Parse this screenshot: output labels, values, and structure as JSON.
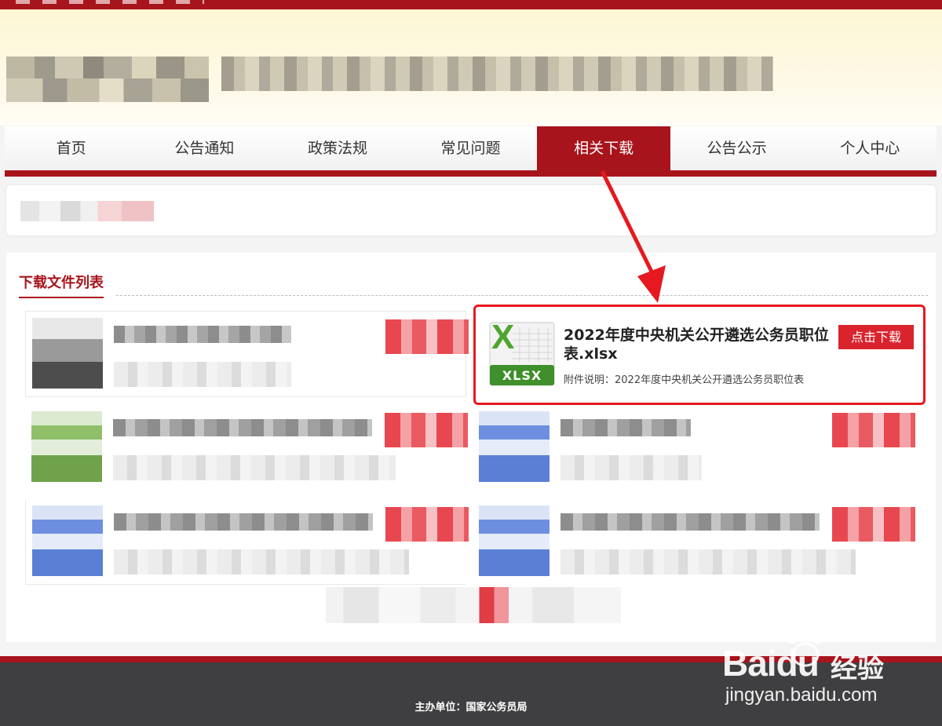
{
  "nav": {
    "items": [
      "首页",
      "公告通知",
      "政策法规",
      "常见问题",
      "相关下载",
      "公告公示",
      "个人中心"
    ],
    "active_index": 4
  },
  "section": {
    "title": "下载文件列表"
  },
  "featured_file": {
    "name": "2022年度中央机关公开遴选公务员职位表.xlsx",
    "description": "附件说明：2022年度中央机关公开遴选公务员职位表",
    "download_label": "点击下载",
    "icon_badge": "XLSX",
    "icon_letter": "X"
  },
  "footer": {
    "sponsor": "主办单位：国家公务员局"
  },
  "watermark": {
    "logo_text": "Bai",
    "logo_du": "du",
    "logo_suffix": "经验",
    "url": "jingyan.baidu.com"
  },
  "colors": {
    "brand_red": "#a8141c",
    "button_red": "#d9232d",
    "highlight": "#e5191f",
    "footer_bg": "#3f3f41"
  }
}
